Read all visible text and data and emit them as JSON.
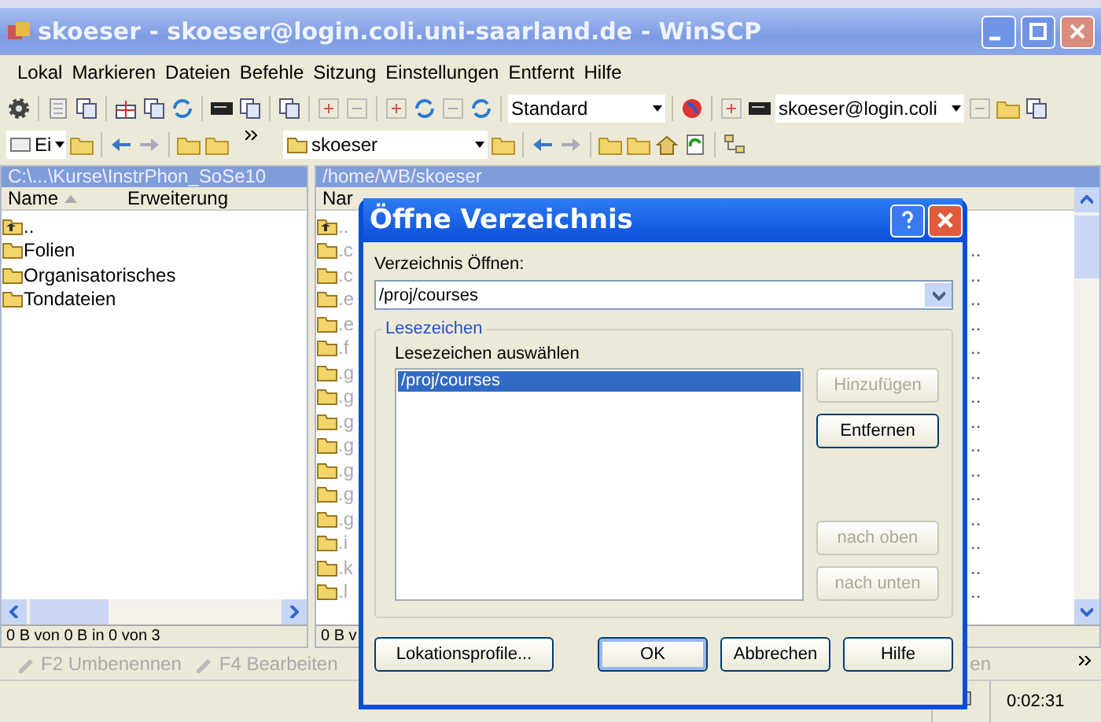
{
  "window": {
    "title": "skoeser - skoeser@login.coli.uni-saarland.de - WinSCP"
  },
  "menu": [
    "Lokal",
    "Markieren",
    "Dateien",
    "Befehle",
    "Sitzung",
    "Einstellungen",
    "Entfernt",
    "Hilfe"
  ],
  "toolbar": {
    "preset": "Standard",
    "session": "skoeser@login.coli"
  },
  "local_panel": {
    "drive": "Ei",
    "path": "C:\\...\\Kurse\\InstrPhon_SoSe10",
    "columns": [
      {
        "label": "Name",
        "sorted": true
      },
      {
        "label": "Erweiterung",
        "sorted": false
      }
    ],
    "rows": [
      {
        "name": "..",
        "kind": "up"
      },
      {
        "name": "Folien",
        "kind": "folder"
      },
      {
        "name": "Organisatorisches",
        "kind": "folder"
      },
      {
        "name": "Tondateien",
        "kind": "folder"
      }
    ],
    "status": "0 B von 0 B in 0 von 3"
  },
  "remote_panel": {
    "folder": "skoeser",
    "path": "/home/WB/skoeser",
    "header": "Nar",
    "rows": [
      {
        "name": "..",
        "kind": "up",
        "rights": ""
      },
      {
        "name": ".c",
        "kind": "folder",
        "rights": ".."
      },
      {
        "name": ".c",
        "kind": "folder",
        "rights": ".."
      },
      {
        "name": ".e",
        "kind": "folder",
        "rights": ".."
      },
      {
        "name": ".e",
        "kind": "folder",
        "rights": ".."
      },
      {
        "name": ".f",
        "kind": "folder",
        "rights": ".."
      },
      {
        "name": ".g",
        "kind": "folder",
        "rights": ".."
      },
      {
        "name": ".g",
        "kind": "folder",
        "rights": ".."
      },
      {
        "name": ".g",
        "kind": "folder",
        "rights": ".."
      },
      {
        "name": ".g",
        "kind": "folder",
        "rights": ".."
      },
      {
        "name": ".g",
        "kind": "folder",
        "rights": ".."
      },
      {
        "name": ".g",
        "kind": "folder",
        "rights": ".."
      },
      {
        "name": ".g",
        "kind": "folder",
        "rights": ".."
      },
      {
        "name": ".i",
        "kind": "folder",
        "rights": ".."
      },
      {
        "name": ".k",
        "kind": "folder",
        "rights": ".."
      },
      {
        "name": ".l",
        "kind": "folder",
        "rights": ".."
      }
    ],
    "status": "0 B v"
  },
  "function_keys": [
    {
      "label": "F2 Umbenennen"
    },
    {
      "label": "F4 Bearbeiten"
    }
  ],
  "function_keys_tail": "en",
  "status_bar": {
    "time": "0:02:31"
  },
  "dialog": {
    "title": "Öffne Verzeichnis",
    "field_label": "Verzeichnis Öffnen:",
    "value": "/proj/courses",
    "group": "Lesezeichen",
    "list_label": "Lesezeichen auswählen",
    "bookmarks": [
      {
        "path": "/proj/courses",
        "selected": true
      }
    ],
    "side_buttons": [
      {
        "label": "Hinzufügen",
        "disabled": true
      },
      {
        "label": "Entfernen",
        "disabled": false
      },
      {
        "label": "nach oben",
        "disabled": true
      },
      {
        "label": "nach unten",
        "disabled": true
      }
    ],
    "buttons": [
      {
        "label": "Lokationsprofile...",
        "default": false
      },
      {
        "label": "OK",
        "default": true
      },
      {
        "label": "Abbrechen",
        "default": false
      },
      {
        "label": "Hilfe",
        "default": false
      }
    ]
  }
}
